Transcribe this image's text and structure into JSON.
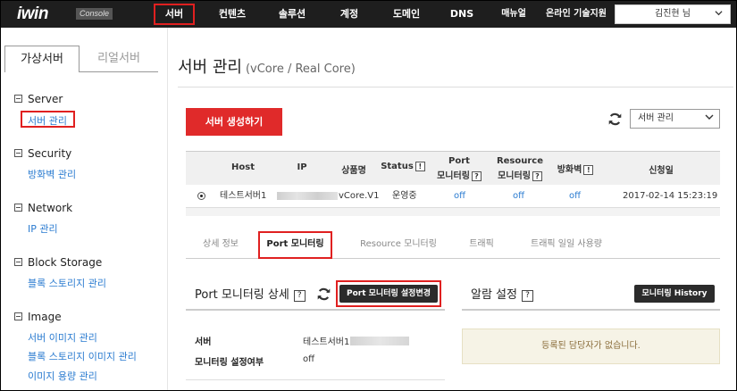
{
  "topbar": {
    "logo": "iwin",
    "logo_badge": "Console",
    "nav": [
      "서버",
      "컨텐츠",
      "솔루션",
      "계정",
      "도메인",
      "DNS",
      "매뉴얼",
      "온라인 기술지원"
    ],
    "user": "김진현 님"
  },
  "sidebar": {
    "tabs": [
      "가상서버",
      "리얼서버"
    ],
    "sections": [
      {
        "title": "Server",
        "links": [
          "서버 관리"
        ]
      },
      {
        "title": "Security",
        "links": [
          "방화벽 관리"
        ]
      },
      {
        "title": "Network",
        "links": [
          "IP 관리"
        ]
      },
      {
        "title": "Block Storage",
        "links": [
          "블록 스토리지 관리"
        ]
      },
      {
        "title": "Image",
        "links": [
          "서버 이미지 관리",
          "블록 스토리지 이미지 관리",
          "이미지 용량 관리"
        ]
      }
    ]
  },
  "main": {
    "title": "서버 관리",
    "title_sub": "(vCore / Real Core)",
    "create_button": "서버 생성하기",
    "select_value": "서버 관리",
    "table": {
      "headers": {
        "host": "Host",
        "ip": "IP",
        "product": "상품명",
        "status": "Status",
        "port_mon_1": "Port",
        "port_mon_2": "모니터링",
        "res_mon_1": "Resource",
        "res_mon_2": "모니터링",
        "firewall": "방화벽",
        "date": "신청일",
        "help": "!",
        "help_q": "?"
      },
      "row": {
        "host": "테스트서버1",
        "product": "vCore.V1",
        "status": "운영중",
        "port_mon": "off",
        "res_mon": "off",
        "firewall": "off",
        "date": "2017-02-14 15:23:19"
      }
    },
    "detail_tabs": [
      "상세 정보",
      "Port 모니터링",
      "Resource 모니터링",
      "트래픽",
      "트래픽 일일 사용량"
    ],
    "port_section": {
      "title": "Port 모니터링 상세",
      "help": "?",
      "setting_button": "Port 모니터링 설정변경",
      "fields": [
        {
          "label": "서버",
          "value": "테스트서버1"
        },
        {
          "label": "모니터링 설정여부",
          "value": "off"
        }
      ]
    },
    "alarm_section": {
      "title": "알람 설정",
      "help": "?",
      "history_button": "모니터링 History",
      "empty_message": "등록된 담당자가 없습니다."
    }
  },
  "colors": {
    "accent": "#e02a2a",
    "topbar": "#1e1e1e",
    "link": "#2a7bd0",
    "highlight": "#e02020"
  },
  "icons": [
    "refresh-icon",
    "chevron-down-icon",
    "collapse-box-icon",
    "help-icon"
  ]
}
